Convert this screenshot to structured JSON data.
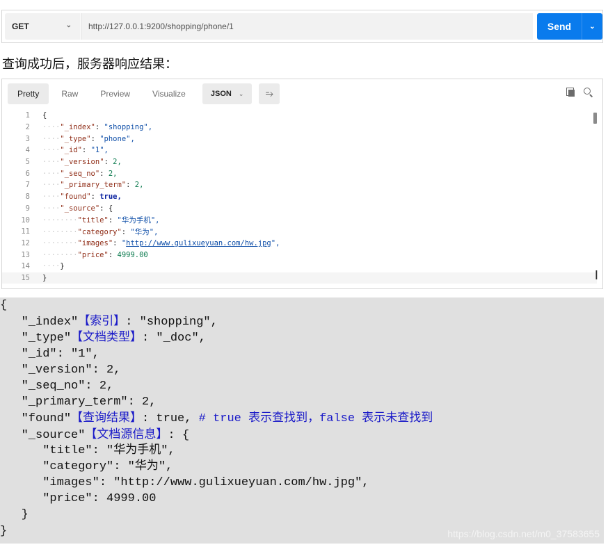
{
  "request": {
    "method": "GET",
    "url": "http://127.0.0.1:9200/shopping/phone/1",
    "send_label": "Send"
  },
  "caption": "查询成功后，服务器响应结果：",
  "response": {
    "tabs": [
      "Pretty",
      "Raw",
      "Preview",
      "Visualize"
    ],
    "active_tab": "Pretty",
    "format": "JSON",
    "icons": [
      "wrap-lines-icon",
      "copy-icon",
      "search-icon"
    ],
    "lines": [
      {
        "n": "1",
        "indent": 0,
        "k": "",
        "v": "",
        "raw": "{",
        "type": "p"
      },
      {
        "n": "2",
        "indent": 1,
        "k": "\"_index\"",
        "v": "\"shopping\",",
        "type": "s"
      },
      {
        "n": "3",
        "indent": 1,
        "k": "\"_type\"",
        "v": "\"phone\",",
        "type": "s"
      },
      {
        "n": "4",
        "indent": 1,
        "k": "\"_id\"",
        "v": "\"1\",",
        "type": "s"
      },
      {
        "n": "5",
        "indent": 1,
        "k": "\"_version\"",
        "v": "2,",
        "type": "n"
      },
      {
        "n": "6",
        "indent": 1,
        "k": "\"_seq_no\"",
        "v": "2,",
        "type": "n"
      },
      {
        "n": "7",
        "indent": 1,
        "k": "\"_primary_term\"",
        "v": "2,",
        "type": "n"
      },
      {
        "n": "8",
        "indent": 1,
        "k": "\"found\"",
        "v": "true,",
        "type": "b"
      },
      {
        "n": "9",
        "indent": 1,
        "k": "\"_source\"",
        "v": "{",
        "type": "p"
      },
      {
        "n": "10",
        "indent": 2,
        "k": "\"title\"",
        "v": "\"华为手机\",",
        "type": "s"
      },
      {
        "n": "11",
        "indent": 2,
        "k": "\"category\"",
        "v": "\"华为\",",
        "type": "s"
      },
      {
        "n": "12",
        "indent": 2,
        "k": "\"images\"",
        "v": "\"http://www.gulixueyuan.com/hw.jpg\",",
        "type": "u"
      },
      {
        "n": "13",
        "indent": 2,
        "k": "\"price\"",
        "v": "4999.00",
        "type": "n"
      },
      {
        "n": "14",
        "indent": 1,
        "k": "",
        "v": "",
        "raw": "}",
        "type": "p"
      },
      {
        "n": "15",
        "indent": 0,
        "k": "",
        "v": "",
        "raw": "}",
        "type": "p"
      }
    ]
  },
  "annotated": {
    "lines": [
      {
        "text": "{"
      },
      {
        "text": "   \"_index\"",
        "cn": "【索引】",
        "rest": ": \"shopping\","
      },
      {
        "text": "   \"_type\"",
        "cn": "【文档类型】",
        "rest": ": \"_doc\","
      },
      {
        "text": "   \"_id\": \"1\","
      },
      {
        "text": "   \"_version\": 2,"
      },
      {
        "text": "   \"_seq_no\": 2,"
      },
      {
        "text": "   \"_primary_term\": 2,"
      },
      {
        "text": "   \"found\"",
        "cn": "【查询结果】",
        "rest": ": true, ",
        "comment": "# true 表示查找到，false 表示未查找到"
      },
      {
        "text": "   \"_source\"",
        "cn": "【文档源信息】",
        "rest": ": {"
      },
      {
        "text": "      \"title\": \"华为手机\","
      },
      {
        "text": "      \"category\": \"华为\","
      },
      {
        "text": "      \"images\": \"http://www.gulixueyuan.com/hw.jpg\","
      },
      {
        "text": "      \"price\": 4999.00"
      },
      {
        "text": "   }"
      },
      {
        "text": "}"
      }
    ],
    "watermark": "https://blog.csdn.net/m0_37583655"
  }
}
